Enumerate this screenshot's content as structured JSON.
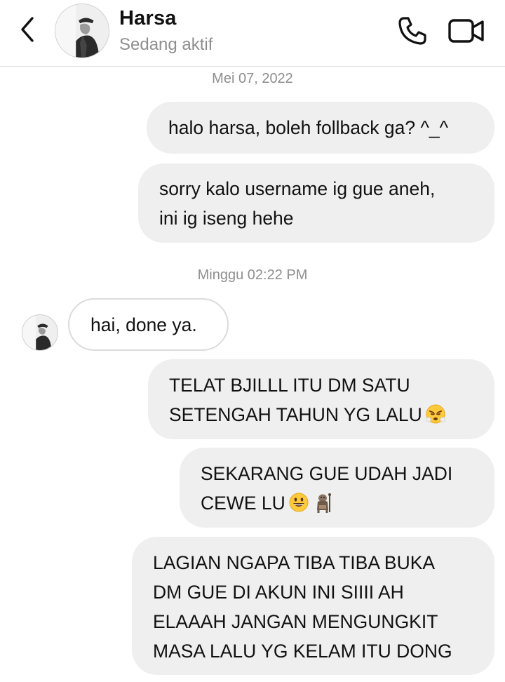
{
  "header": {
    "contact_name": "Harsa",
    "status": "Sedang aktif",
    "back_icon": "chevron-left-icon",
    "call_icon": "phone-icon",
    "video_icon": "video-camera-icon"
  },
  "timestamps": [
    "Mei 07, 2022",
    "Minggu 02:22 PM"
  ],
  "messages": [
    {
      "direction": "outgoing",
      "lines": [
        "halo harsa, boleh follback ga? ^_^"
      ]
    },
    {
      "direction": "outgoing",
      "lines": [
        "sorry kalo username ig gue aneh,",
        "ini ig iseng hehe"
      ]
    },
    {
      "direction": "incoming",
      "lines": [
        "hai, done ya."
      ]
    },
    {
      "direction": "outgoing",
      "lines": [
        "TELAT BJILLL ITU DM SATU",
        "SETENGAH TAHUN YG LALU"
      ],
      "emojis": [
        "steaming-face-emoji"
      ]
    },
    {
      "direction": "outgoing",
      "lines": [
        "SEKARANG GUE UDAH JADI",
        "CEWE LU"
      ],
      "emojis": [
        "grinning-face-emoji",
        "troll-emoji"
      ]
    },
    {
      "direction": "outgoing",
      "lines": [
        "LAGIAN NGAPA TIBA TIBA BUKA",
        "DM GUE DI AKUN INI SIIII AH",
        "ELAAAH JANGAN MENGUNGKIT",
        "MASA LALU YG KELAM ITU DONG"
      ]
    }
  ],
  "colors": {
    "outgoing_bubble": "#efefef",
    "incoming_border": "#dbdbdb",
    "secondary_text": "#8e8e8e",
    "primary_text": "#111111"
  }
}
